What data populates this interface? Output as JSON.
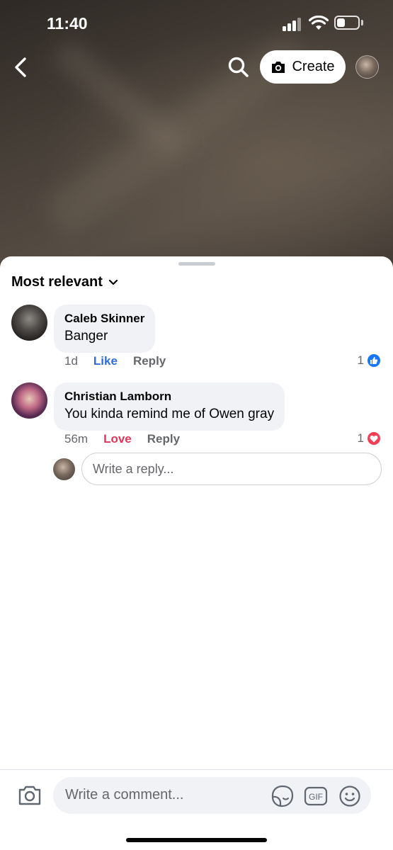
{
  "status_bar": {
    "time": "11:40",
    "battery_level": 0.4
  },
  "top_nav": {
    "back_icon": "chevron-left-icon",
    "search_icon": "search-icon",
    "create_label": "Create",
    "create_icon": "camera-icon"
  },
  "sort": {
    "label": "Most relevant",
    "icon": "chevron-down-icon"
  },
  "comments": [
    {
      "author": "Caleb Skinner",
      "text": "Banger",
      "time": "1d",
      "reaction_action": "Like",
      "reply_label": "Reply",
      "reaction_count": "1",
      "reaction_type": "like",
      "reaction_color": "#1877f2"
    },
    {
      "author": "Christian Lamborn",
      "text": "You kinda remind me of Owen gray",
      "time": "56m",
      "reaction_action": "Love",
      "reply_label": "Reply",
      "reaction_count": "1",
      "reaction_type": "love",
      "reaction_color": "#f33e58"
    }
  ],
  "reply_box": {
    "placeholder": "Write a reply..."
  },
  "composer": {
    "placeholder": "Write a comment...",
    "icons": [
      "camera-icon",
      "sticker-icon",
      "gif-icon",
      "emoji-icon"
    ]
  }
}
